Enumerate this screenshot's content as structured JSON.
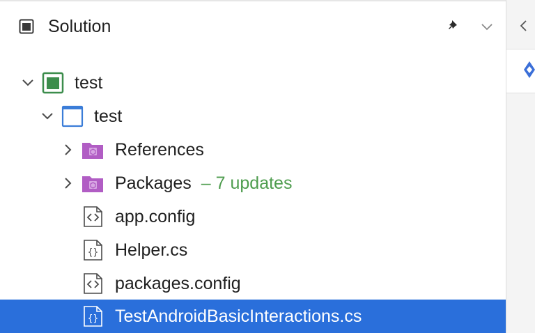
{
  "header": {
    "title": "Solution",
    "icon": "solution-panel-icon",
    "actions": [
      "pin-icon",
      "chevron-down-icon"
    ]
  },
  "tree": [
    {
      "id": "solution",
      "label": "test",
      "icon": "solution-icon",
      "expanded": true
    },
    {
      "id": "project",
      "label": "test",
      "icon": "project-icon",
      "expanded": true
    },
    {
      "id": "references",
      "label": "References",
      "icon": "package-folder-icon",
      "expanded": false
    },
    {
      "id": "packages",
      "label": "Packages",
      "suffix": "– 7 updates",
      "icon": "package-folder-icon",
      "expanded": false
    },
    {
      "id": "app-config",
      "label": "app.config",
      "icon": "config-file-icon"
    },
    {
      "id": "helper-cs",
      "label": "Helper.cs",
      "icon": "csharp-file-icon"
    },
    {
      "id": "packages-config",
      "label": "packages.config",
      "icon": "config-file-icon"
    },
    {
      "id": "test-android",
      "label": "TestAndroidBasicInteractions.cs",
      "icon": "csharp-file-icon",
      "selected": true
    }
  ],
  "colors": {
    "selection": "#2a6fdb",
    "update_text": "#4f9d4f",
    "folder": "#b15dc4",
    "project_blue": "#3b7dd8",
    "solution_green": "#3c8d4c"
  }
}
